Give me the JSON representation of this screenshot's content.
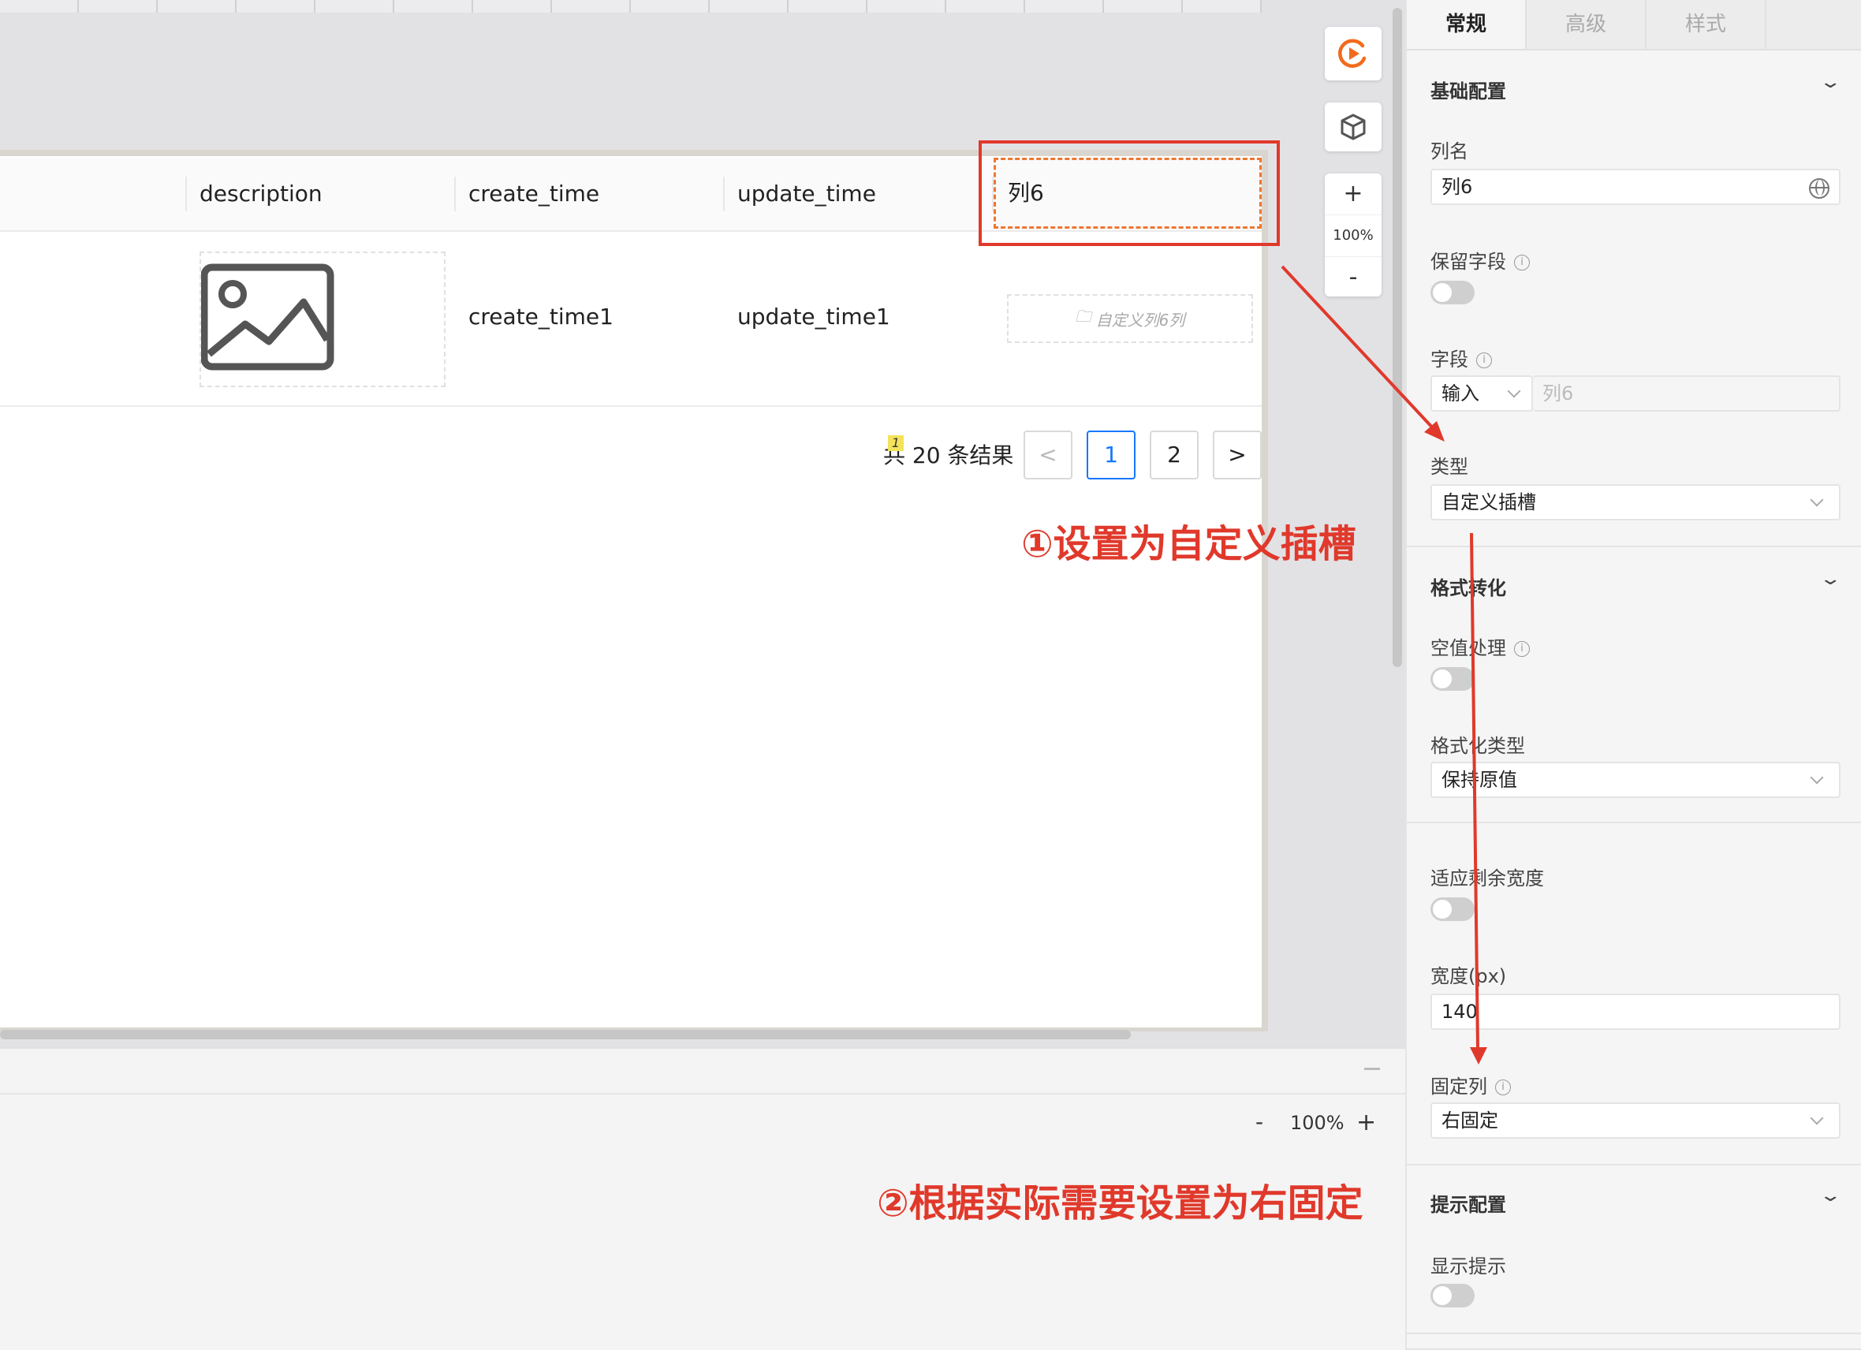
{
  "table": {
    "headers": [
      "description",
      "create_time",
      "update_time",
      "列6"
    ],
    "row": {
      "create_time": "create_time1",
      "update_time": "update_time1",
      "slot_placeholder": "自定义列6列"
    }
  },
  "pagination": {
    "total_text": "共 20 条结果",
    "badge": "1",
    "prev": "<",
    "pages": [
      "1",
      "2"
    ],
    "next": ">"
  },
  "canvas_tools": {
    "zoom_in": "+",
    "zoom_level": "100%",
    "zoom_out": "-"
  },
  "bottom_bar": {
    "zoom_out": "-",
    "zoom_level": "100%",
    "zoom_in": "+"
  },
  "annotations": {
    "step1": "①设置为自定义插槽",
    "step2": "②根据实际需要设置为右固定",
    "color": "#e0392b"
  },
  "panel": {
    "tabs": [
      "常规",
      "高级",
      "样式"
    ],
    "sections": {
      "basic": "基础配置",
      "format": "格式转化",
      "tips": "提示配置"
    },
    "labels": {
      "column_name": "列名",
      "keep_field": "保留字段",
      "field": "字段",
      "type": "类型",
      "null_handling": "空值处理",
      "format_type": "格式化类型",
      "fit_width": "适应剩余宽度",
      "width": "宽度(px)",
      "fixed_column": "固定列",
      "show_tips": "显示提示"
    },
    "values": {
      "column_name": "列6",
      "field_mode": "输入",
      "field_name": "列6",
      "type": "自定义插槽",
      "format_type": "保持原值",
      "width": "140",
      "fixed_column": "右固定"
    },
    "toggles": {
      "keep_field": false,
      "null_handling": false,
      "fit_width": false,
      "show_tips": false
    }
  },
  "colors": {
    "accent": "#1677ff",
    "highlight": "#e0392b",
    "dash": "#ee7733"
  }
}
